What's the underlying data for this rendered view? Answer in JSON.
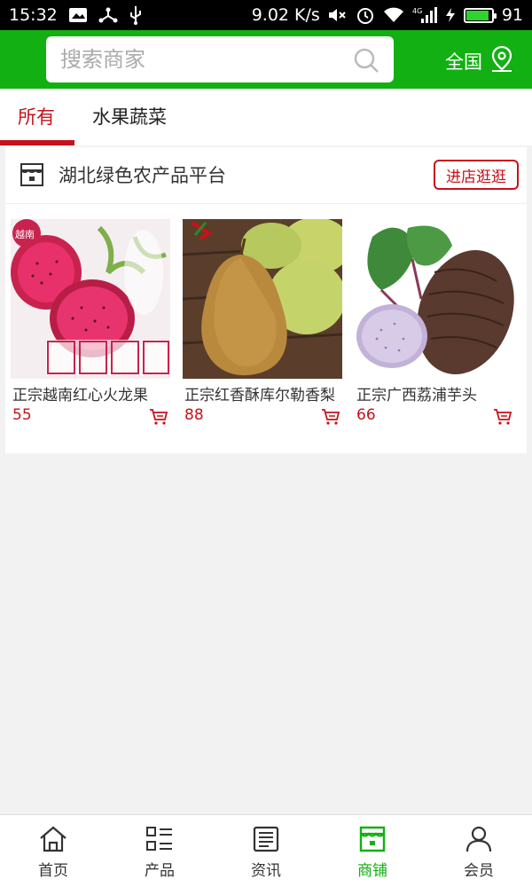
{
  "status_bar": {
    "time": "15:32",
    "speed": "9.02 K/s",
    "network": "4G",
    "battery": "91",
    "battery_level": 0.91
  },
  "header": {
    "search_placeholder": "搜索商家",
    "region_label": "全国"
  },
  "tabs": [
    {
      "label": "所有",
      "active": true
    },
    {
      "label": "水果蔬菜",
      "active": false
    }
  ],
  "store": {
    "name": "湖北绿色农产品平台",
    "visit_label": "进店逛逛"
  },
  "products": [
    {
      "title": "正宗越南红心火龙果",
      "price": "55",
      "image": "dragon-fruit",
      "badge": "越南"
    },
    {
      "title": "正宗红香酥库尔勒香梨",
      "price": "88",
      "image": "pear"
    },
    {
      "title": "正宗广西荔浦芋头",
      "price": "66",
      "image": "taro"
    }
  ],
  "bottom_nav": [
    {
      "label": "首页",
      "icon": "home-icon",
      "active": false
    },
    {
      "label": "产品",
      "icon": "list-icon",
      "active": false
    },
    {
      "label": "资讯",
      "icon": "news-icon",
      "active": false
    },
    {
      "label": "商铺",
      "icon": "shop-icon",
      "active": true
    },
    {
      "label": "会员",
      "icon": "user-icon",
      "active": false
    }
  ],
  "colors": {
    "brand_green": "#13b013",
    "accent_red": "#c6121b",
    "background": "#f2f2f2"
  }
}
